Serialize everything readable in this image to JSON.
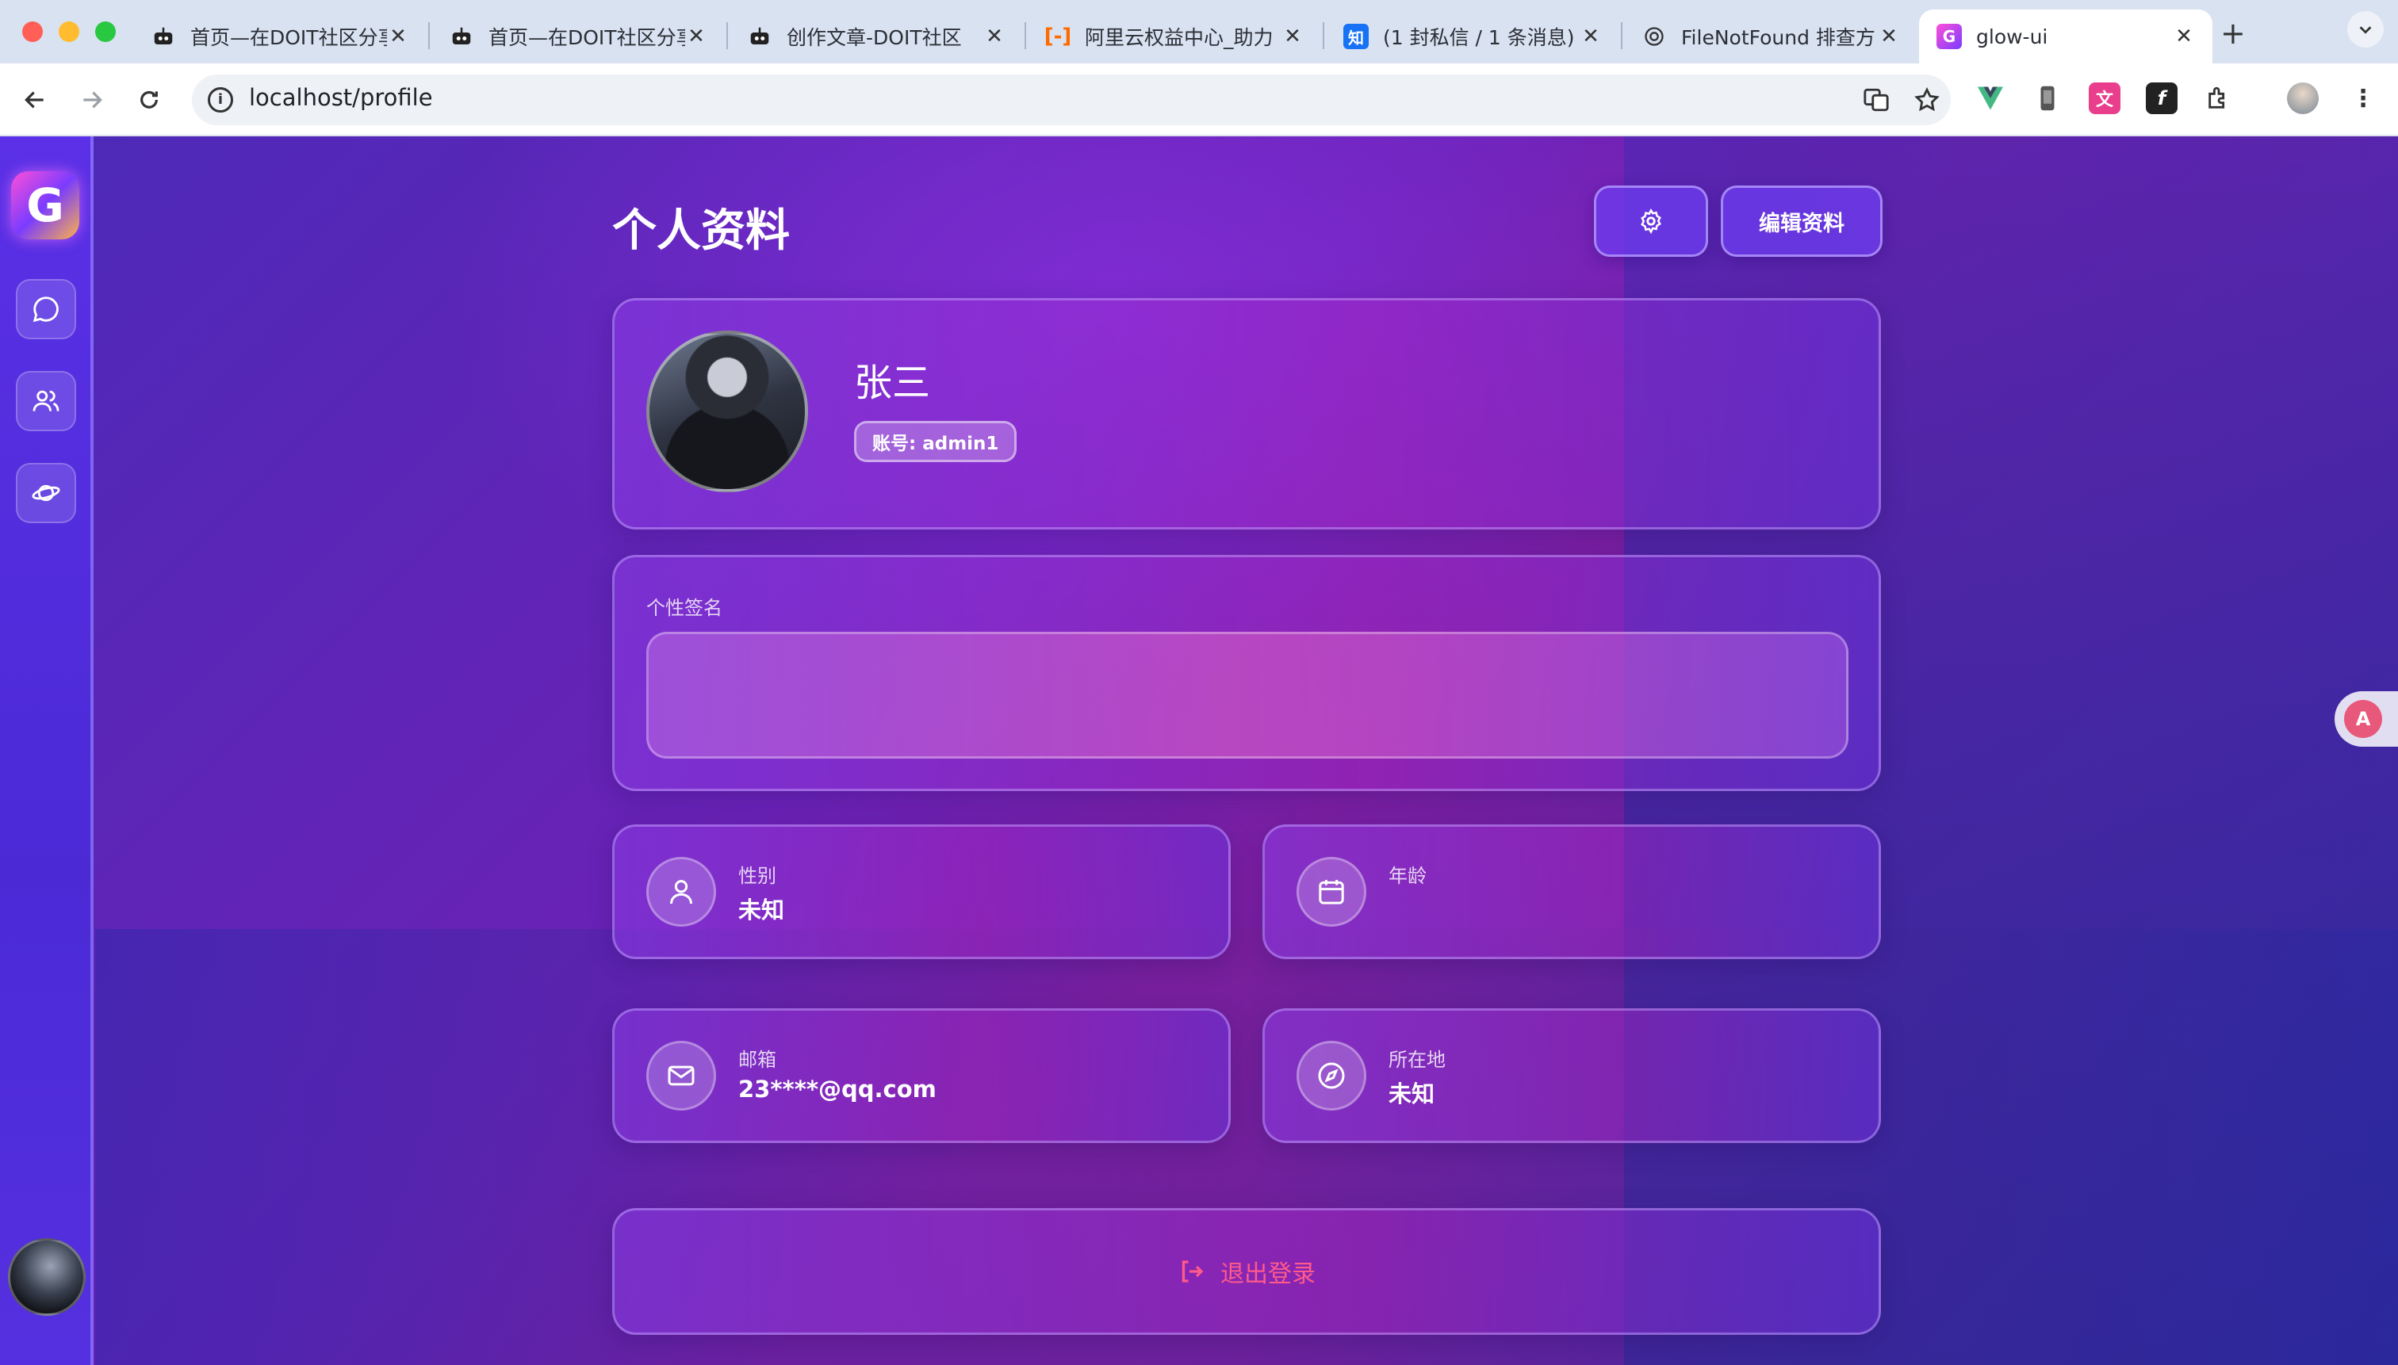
{
  "browser": {
    "tabs": [
      {
        "title": "首页—在DOIT社区分享",
        "icon": "robot-icon"
      },
      {
        "title": "首页—在DOIT社区分享",
        "icon": "robot-icon"
      },
      {
        "title": "创作文章-DOIT社区",
        "icon": "robot-icon"
      },
      {
        "title": "阿里云权益中心_助力",
        "icon": "aliyun-icon"
      },
      {
        "title": "(1 封私信 / 1 条消息)",
        "icon": "zhihu-icon",
        "favicon_text": "知"
      },
      {
        "title": "FileNotFound 排查方",
        "icon": "openai-icon"
      },
      {
        "title": "glow-ui",
        "icon": "glow-logo-icon",
        "active": true
      }
    ],
    "close_glyph": "✕",
    "new_tab_glyph": "+",
    "url": "localhost/profile"
  },
  "sidebar": {
    "logo_letter": "G",
    "items": [
      {
        "name": "chat",
        "icon": "chat-bubble-icon"
      },
      {
        "name": "friends",
        "icon": "users-icon"
      },
      {
        "name": "explore",
        "icon": "planet-icon"
      }
    ]
  },
  "profile": {
    "page_title": "个人资料",
    "edit_label": "编辑资料",
    "settings_icon": "gear-icon",
    "name": "张三",
    "account_badge": "账号: admin1",
    "signature_label": "个性签名",
    "signature_value": "",
    "fields": {
      "gender": {
        "label": "性别",
        "value": "未知",
        "icon": "user-icon"
      },
      "age": {
        "label": "年龄",
        "value": "",
        "icon": "calendar-icon"
      },
      "email": {
        "label": "邮箱",
        "value": "23****@qq.com",
        "icon": "mail-icon"
      },
      "location": {
        "label": "所在地",
        "value": "未知",
        "icon": "compass-icon"
      }
    },
    "logout_label": "退出登录"
  },
  "colors": {
    "accent": "#6d3cf0",
    "logout_text": "#ff5a8a",
    "sidebar": "#5b30e6"
  }
}
